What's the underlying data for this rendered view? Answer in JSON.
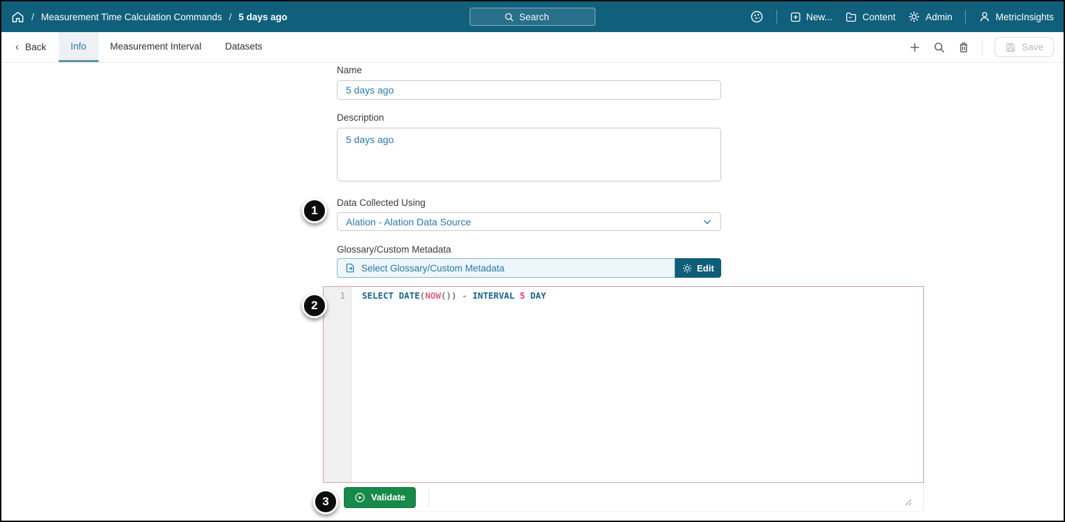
{
  "header": {
    "breadcrumb": {
      "sep1": "/",
      "section": "Measurement Time Calculation Commands",
      "sep2": "/",
      "current": "5 days ago"
    },
    "search": {
      "placeholder": "Search"
    },
    "actions": {
      "new_label": "New...",
      "content_label": "Content",
      "admin_label": "Admin",
      "user_label": "MetricInsights"
    }
  },
  "toolbar": {
    "back_label": "Back",
    "tabs": [
      {
        "label": "Info",
        "active": true
      },
      {
        "label": "Measurement Interval",
        "active": false
      },
      {
        "label": "Datasets",
        "active": false
      }
    ],
    "save_label": "Save"
  },
  "form": {
    "name": {
      "label": "Name",
      "value": "5 days ago"
    },
    "description": {
      "label": "Description",
      "value": "5 days ago"
    },
    "data_collected": {
      "label": "Data Collected Using",
      "value": "Alation - Alation Data Source"
    },
    "glossary": {
      "label": "Glossary/Custom Metadata",
      "placeholder": "Select Glossary/Custom Metadata",
      "edit_label": "Edit"
    }
  },
  "editor": {
    "line_number": "1",
    "code_text": "SELECT DATE(NOW()) - INTERVAL 5 DAY",
    "tokens": [
      {
        "t": "SELECT "
      },
      {
        "t": "DATE"
      },
      {
        "t": "("
      },
      {
        "t": "NOW"
      },
      {
        "t": "())"
      },
      {
        "t": " - "
      },
      {
        "t": "INTERVAL "
      },
      {
        "t": "5"
      },
      {
        "t": " DAY"
      }
    ],
    "validate_label": "Validate"
  },
  "annotations": {
    "badge1": "1",
    "badge2": "2",
    "badge3": "3"
  },
  "colors": {
    "header_bg": "#10607c",
    "accent_teal": "#2879a8",
    "active_tab_bg": "#edf1f5",
    "edit_button_bg": "#0f5d78",
    "validate_green": "#178a4a",
    "editor_error_border": "#d6a2a2",
    "keyword_blue": "#1b648c",
    "function_pink": "#e0607e",
    "number_magenta": "#d33682",
    "badge_black": "#0d0d0d"
  }
}
